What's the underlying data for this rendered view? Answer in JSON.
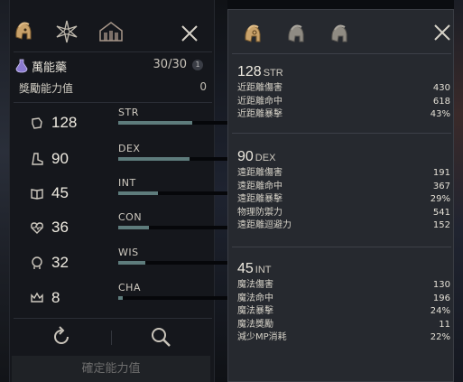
{
  "left_panel": {
    "potion": {
      "name": "萬能藥",
      "count": "30/30",
      "badge": "1"
    },
    "bonus": {
      "label": "獎勵能力值",
      "value": "0"
    },
    "stats": [
      {
        "abbr": "STR",
        "value": "128",
        "level": 0.62,
        "icon": "fist-icon"
      },
      {
        "abbr": "DEX",
        "value": "90",
        "level": 0.6,
        "icon": "boot-icon"
      },
      {
        "abbr": "INT",
        "value": "45",
        "level": 0.33,
        "icon": "book-icon"
      },
      {
        "abbr": "CON",
        "value": "36",
        "level": 0.26,
        "icon": "heart-icon"
      },
      {
        "abbr": "WIS",
        "value": "32",
        "level": 0.23,
        "icon": "head-icon"
      },
      {
        "abbr": "CHA",
        "value": "8",
        "level": 0.04,
        "icon": "crown-icon"
      }
    ],
    "confirm_label": "確定能力值"
  },
  "right_panel": {
    "sections": [
      {
        "value": "128",
        "abbr": "STR",
        "lines": [
          {
            "label": "近距離傷害",
            "value": "430"
          },
          {
            "label": "近距離命中",
            "value": "618"
          },
          {
            "label": "近距離暴擊",
            "value": "43%"
          }
        ]
      },
      {
        "value": "90",
        "abbr": "DEX",
        "lines": [
          {
            "label": "遠距離傷害",
            "value": "191"
          },
          {
            "label": "遠距離命中",
            "value": "367"
          },
          {
            "label": "遠距離暴擊",
            "value": "29%"
          },
          {
            "label": "物理防禦力",
            "value": "541"
          },
          {
            "label": "遠距離迴避力",
            "value": "152"
          }
        ]
      },
      {
        "value": "45",
        "abbr": "INT",
        "lines": [
          {
            "label": "魔法傷害",
            "value": "130"
          },
          {
            "label": "魔法命中",
            "value": "196"
          },
          {
            "label": "魔法暴擊",
            "value": "24%"
          },
          {
            "label": "魔法獎勵",
            "value": "11"
          },
          {
            "label": "減少MP消耗",
            "value": "22%"
          }
        ]
      }
    ]
  },
  "colors": {
    "bar_fill": "#5e7c7c",
    "gold_icon": "#c9a26a",
    "panel_bg": "#15171c",
    "right_bg": "#26292f"
  }
}
